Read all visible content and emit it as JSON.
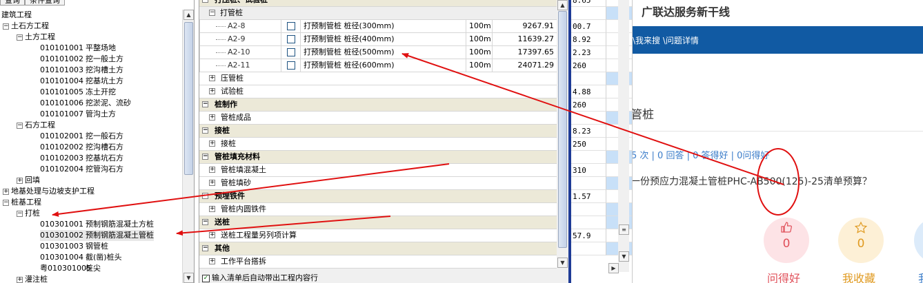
{
  "left_panel": {
    "tabs": [
      "查询",
      "条件查询"
    ],
    "tree": [
      {
        "depth": 0,
        "toggle": "",
        "text": "建筑工程"
      },
      {
        "depth": 0,
        "toggle": "−",
        "text": "土石方工程"
      },
      {
        "depth": 1,
        "toggle": "−",
        "text": "土方工程"
      },
      {
        "depth": 2,
        "code": "010101001",
        "text": "平整场地"
      },
      {
        "depth": 2,
        "code": "010101002",
        "text": "挖一般土方"
      },
      {
        "depth": 2,
        "code": "010101003",
        "text": "挖沟槽土方"
      },
      {
        "depth": 2,
        "code": "010101004",
        "text": "挖基坑土方"
      },
      {
        "depth": 2,
        "code": "010101005",
        "text": "冻土开挖"
      },
      {
        "depth": 2,
        "code": "010101006",
        "text": "挖淤泥、流砂"
      },
      {
        "depth": 2,
        "code": "010101007",
        "text": "管沟土方"
      },
      {
        "depth": 1,
        "toggle": "−",
        "text": "石方工程"
      },
      {
        "depth": 2,
        "code": "010102001",
        "text": "挖一般石方"
      },
      {
        "depth": 2,
        "code": "010102002",
        "text": "挖沟槽石方"
      },
      {
        "depth": 2,
        "code": "010102003",
        "text": "挖基坑石方"
      },
      {
        "depth": 2,
        "code": "010102004",
        "text": "挖管沟石方"
      },
      {
        "depth": 1,
        "toggle": "+",
        "text": "回填"
      },
      {
        "depth": 0,
        "toggle": "+",
        "text": "地基处理与边坡支护工程"
      },
      {
        "depth": 0,
        "toggle": "−",
        "text": "桩基工程"
      },
      {
        "depth": 1,
        "toggle": "−",
        "text": "打桩"
      },
      {
        "depth": 2,
        "code": "010301001",
        "text": "预制钢筋混凝土方桩"
      },
      {
        "depth": 2,
        "code": "010301002",
        "text": "预制钢筋混凝土管桩",
        "selected": true
      },
      {
        "depth": 2,
        "code": "010301003",
        "text": "钢管桩"
      },
      {
        "depth": 2,
        "code": "010301004",
        "text": "截(凿)桩头"
      },
      {
        "depth": 2,
        "code": "粤010301005",
        "text": "桩尖"
      },
      {
        "depth": 1,
        "toggle": "+",
        "text": "灌注桩"
      }
    ]
  },
  "grid": {
    "rows": [
      {
        "kind": "hdr",
        "toggle": "−",
        "text": "打压桩、试验桩"
      },
      {
        "kind": "hdr2",
        "toggle": "−",
        "text": "打管桩"
      },
      {
        "kind": "item",
        "code": "A2-8",
        "name": "打预制管桩 桩径(300mm)",
        "unit": "100m",
        "price": "9267.91"
      },
      {
        "kind": "item",
        "code": "A2-9",
        "name": "打预制管桩 桩径(400mm)",
        "unit": "100m",
        "price": "11639.27"
      },
      {
        "kind": "item",
        "code": "A2-10",
        "name": "打预制管桩 桩径(500mm)",
        "unit": "100m",
        "price": "17397.65"
      },
      {
        "kind": "item",
        "code": "A2-11",
        "name": "打预制管桩 桩径(600mm)",
        "unit": "100m",
        "price": "24071.29"
      },
      {
        "kind": "child",
        "toggle": "+",
        "text": "压管桩"
      },
      {
        "kind": "child",
        "toggle": "+",
        "text": "试验桩"
      },
      {
        "kind": "hdr",
        "toggle": "−",
        "text": "桩制作"
      },
      {
        "kind": "child",
        "toggle": "+",
        "text": "管桩成品"
      },
      {
        "kind": "hdr",
        "toggle": "−",
        "text": "接桩"
      },
      {
        "kind": "child",
        "toggle": "+",
        "text": "接桩"
      },
      {
        "kind": "hdr",
        "toggle": "−",
        "text": "管桩填充材料"
      },
      {
        "kind": "child",
        "toggle": "+",
        "text": "管桩填混凝土"
      },
      {
        "kind": "child",
        "toggle": "+",
        "text": "管桩填砂"
      },
      {
        "kind": "hdr",
        "toggle": "−",
        "text": "预埋铁件"
      },
      {
        "kind": "child",
        "toggle": "+",
        "text": "管桩内圆铁件"
      },
      {
        "kind": "hdr",
        "toggle": "−",
        "text": "送桩"
      },
      {
        "kind": "child",
        "toggle": "+",
        "text": "送桩工程量另列项计算"
      },
      {
        "kind": "hdr",
        "toggle": "−",
        "text": "其他"
      },
      {
        "kind": "child",
        "toggle": "+",
        "text": "工作平台搭拆"
      }
    ],
    "bottom_checkbox_label": "输入清单后自动带出工程内容行"
  },
  "strip": {
    "values": [
      "8.65",
      "",
      "00.7",
      "8.92",
      "2.23",
      "260",
      "",
      "4.88",
      "260",
      "",
      "8.23",
      "250",
      "",
      "310",
      "",
      "1.57",
      "",
      "",
      "57.9",
      ""
    ]
  },
  "web": {
    "site_title": "广联达服务新干线",
    "breadcrumb": "\\我来搜 \\问题详情",
    "category": "管桩",
    "stats": "5 次 | 0 回答 | 0 答得好 | 0问得好",
    "question": "一份预应力混凝土管桩PHC-AB500(125)-25清单预算？",
    "actions": [
      {
        "label": "问得好",
        "count": "0",
        "icon": "thumbs-up-icon"
      },
      {
        "label": "我收藏",
        "count": "0",
        "icon": "star-icon"
      },
      {
        "label": "我",
        "count": "",
        "icon": ""
      }
    ],
    "colors": {
      "navbar": "#115aa3",
      "good": "#e0505a",
      "fav": "#e09a20"
    }
  }
}
